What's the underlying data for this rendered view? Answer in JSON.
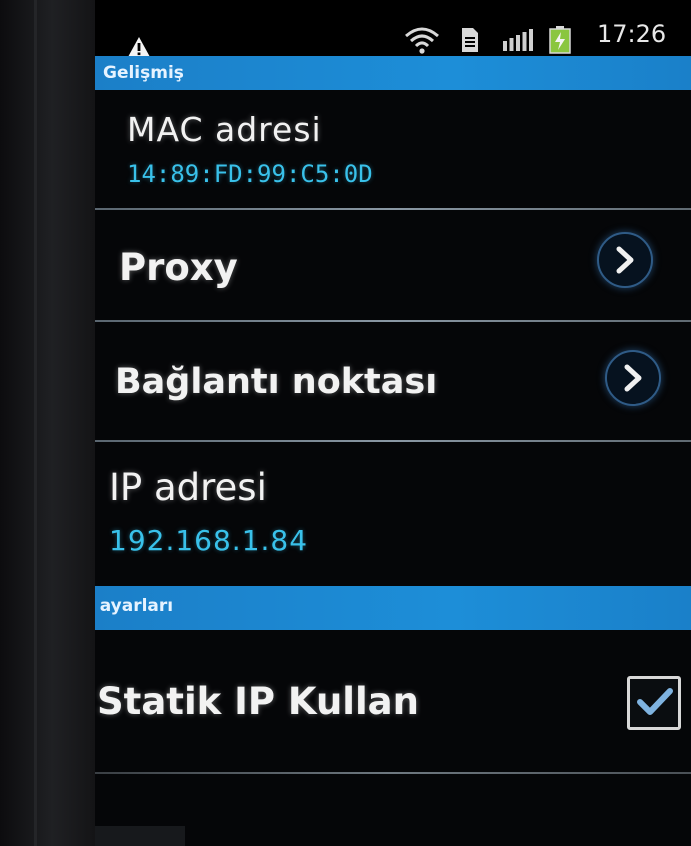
{
  "status_bar": {
    "time": "17:26",
    "icons": [
      "warning-icon",
      "wifi-icon",
      "sim-card-icon",
      "signal-icon",
      "battery-icon"
    ]
  },
  "sections": {
    "advanced": {
      "header": "Gelişmiş"
    },
    "ip_settings": {
      "header": "IP ayarları"
    }
  },
  "items": {
    "mac": {
      "title": "MAC adresi",
      "value": "14:89:FD:99:C5:0D"
    },
    "proxy": {
      "title": "Proxy"
    },
    "hotspot": {
      "title": "Bağlantı noktası"
    },
    "ip": {
      "title": "IP adresi",
      "value": "192.168.1.84"
    },
    "static_ip": {
      "title": "Statik IP Kullan",
      "checked": true
    }
  },
  "colors": {
    "header_blue": "#1d8ed8",
    "value_cyan": "#39c1ea",
    "text_white": "#f2f2f2"
  }
}
